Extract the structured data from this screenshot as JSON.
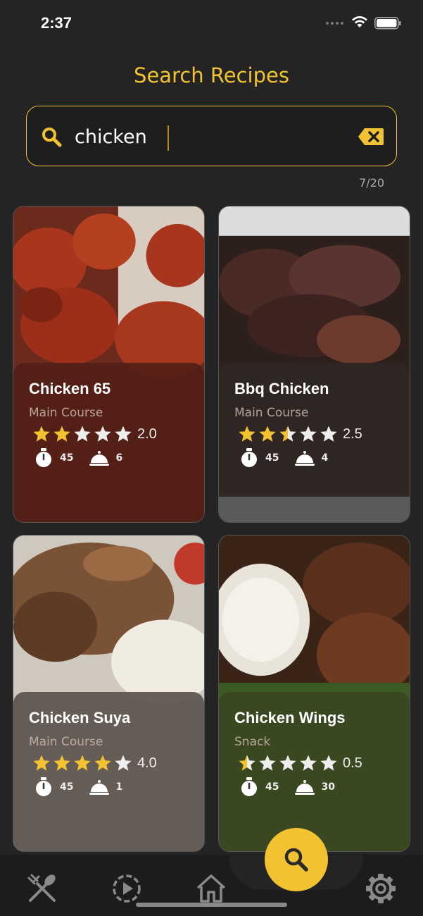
{
  "status_bar": {
    "time": "2:37"
  },
  "page": {
    "title": "Search Recipes"
  },
  "search": {
    "value": "chicken",
    "placeholder": "",
    "result_count": "7/20"
  },
  "colors": {
    "accent": "#f2c230",
    "background": "#242424"
  },
  "recipes": [
    {
      "title": "Chicken 65",
      "category": "Main Course",
      "rating": 2.0,
      "rating_label": "2.0",
      "time": "45",
      "servings": "6"
    },
    {
      "title": "Bbq Chicken",
      "category": "Main Course",
      "rating": 2.5,
      "rating_label": "2.5",
      "time": "45",
      "servings": "4"
    },
    {
      "title": "Chicken Suya",
      "category": "Main Course",
      "rating": 4.0,
      "rating_label": "4.0",
      "time": "45",
      "servings": "1"
    },
    {
      "title": "Chicken Wings",
      "category": "Snack",
      "rating": 0.5,
      "rating_label": "0.5",
      "time": "45",
      "servings": "30"
    }
  ],
  "nav": {
    "items": [
      {
        "icon": "utensils-icon"
      },
      {
        "icon": "play-circle-icon"
      },
      {
        "icon": "home-icon"
      },
      {
        "icon": "search-icon",
        "active": true
      },
      {
        "icon": "settings-icon"
      }
    ]
  }
}
